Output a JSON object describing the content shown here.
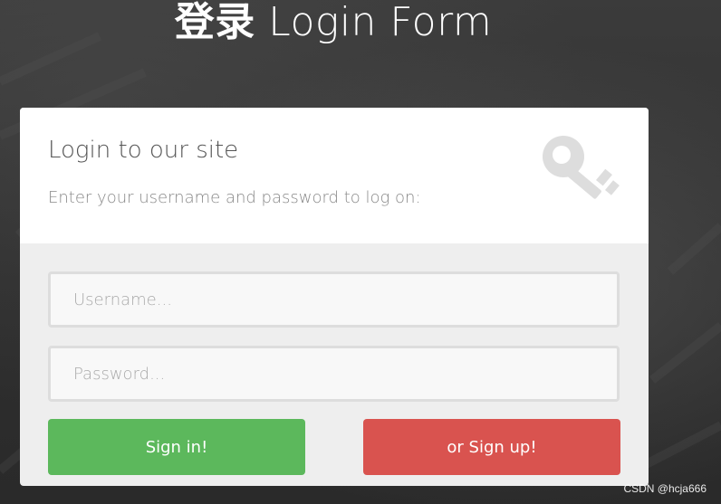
{
  "page": {
    "title_cn": "登录",
    "title_en": "Login Form"
  },
  "card": {
    "heading": "Login to our site",
    "subtitle": "Enter your username and password to log on:",
    "icon": "key-icon"
  },
  "form": {
    "username": {
      "value": "",
      "placeholder": "Username..."
    },
    "password": {
      "value": "",
      "placeholder": "Password..."
    },
    "signin_label": "Sign in!",
    "signup_label": "or Sign up!"
  },
  "watermark": "CSDN @hcja666",
  "colors": {
    "signin": "#5cb85c",
    "signup": "#d9534f",
    "card_top": "#ffffff",
    "card_bottom": "#eeeeee"
  }
}
